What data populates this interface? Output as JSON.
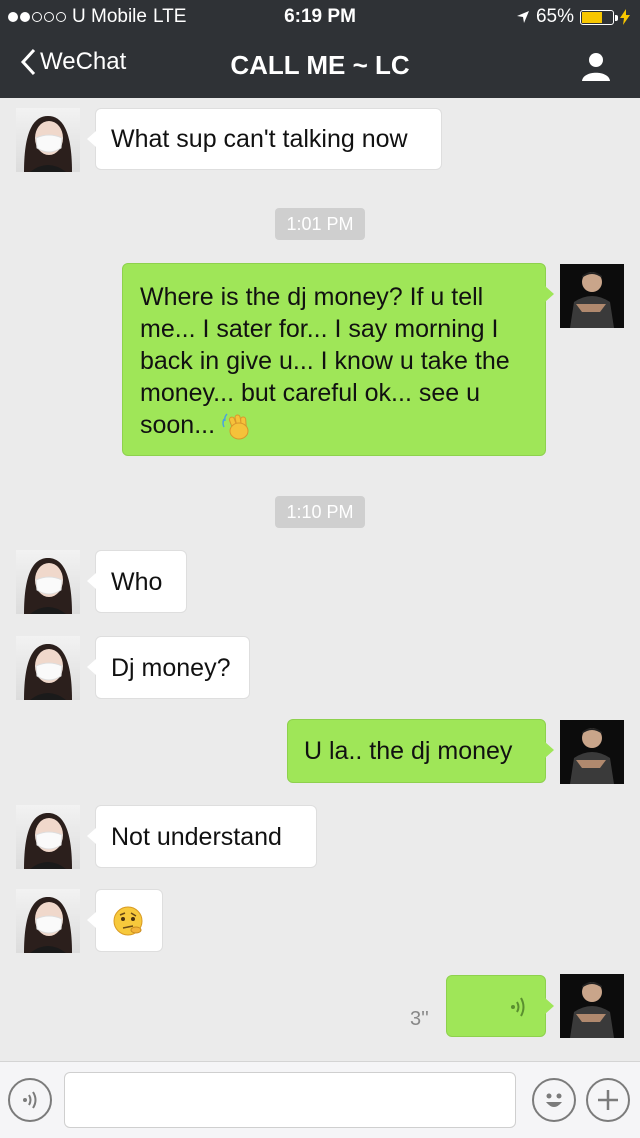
{
  "status": {
    "carrier": "U Mobile",
    "network": "LTE",
    "time": "6:19 PM",
    "battery": "65%",
    "battery_level": 0.65
  },
  "nav": {
    "back_label": "WeChat",
    "title": "CALL ME ~ LC"
  },
  "messages": {
    "m1": "What sup can't talking now",
    "ts1": "1:01 PM",
    "m2_lines": [
      "Where is the dj money? If u tell",
      "me... I sater for... I say morning I",
      "back in give u... I know u take the",
      "money... but careful ok... see u",
      "soon..."
    ],
    "ts2": "1:10 PM",
    "m3": "Who",
    "m4": "Dj money?",
    "m5": "U la.. the dj money",
    "m6": "Not understand",
    "voice_duration": "3''"
  },
  "icons": {
    "back": "chevron-left-icon",
    "profile": "person-icon",
    "wave_emoji": "waving-hand-emoji",
    "thinking_emoji": "thinking-face-emoji",
    "voice_mode": "voice-mode-icon",
    "emoji_button": "smiley-face-icon",
    "plus": "plus-icon"
  },
  "colors": {
    "header_bg": "#2f3236",
    "chat_bg": "#ebebeb",
    "bubble_out": "#9fe658",
    "bubble_in": "#ffffff",
    "battery": "#f7c600"
  }
}
